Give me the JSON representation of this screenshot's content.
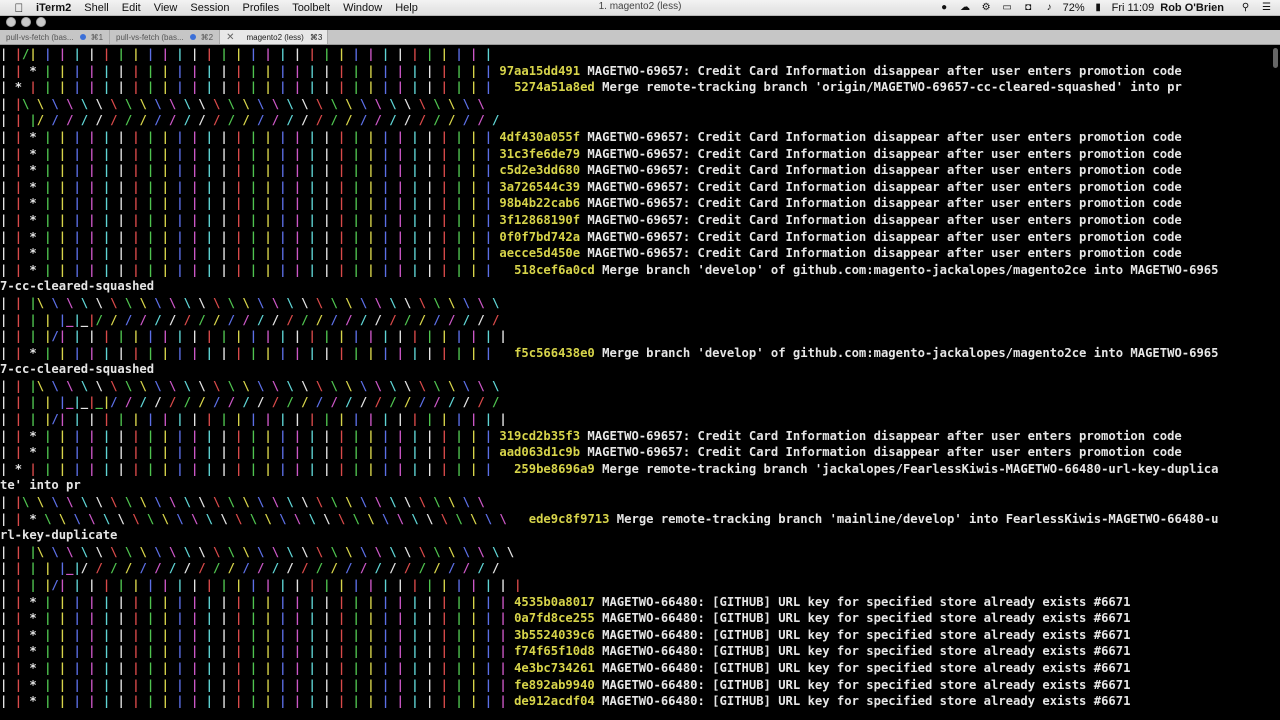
{
  "menubar": {
    "app": "iTerm2",
    "items": [
      "Shell",
      "Edit",
      "View",
      "Session",
      "Profiles",
      "Toolbelt",
      "Window",
      "Help"
    ],
    "window_title": "1. magento2 (less)",
    "status": {
      "battery": "72%",
      "clock": "Fri 11:09",
      "user": "Rob O'Brien"
    }
  },
  "tabs": [
    {
      "title": "pull-vs-fetch (bas...",
      "shortcut": "⌘1"
    },
    {
      "title": "pull-vs-fetch (bas...",
      "shortcut": "⌘2"
    },
    {
      "title": "magento2 (less)",
      "shortcut": "⌘3"
    }
  ],
  "colors": {
    "graph": [
      "#e3e3e3",
      "#d94a4a",
      "#4fc34f",
      "#d7d44a",
      "#5c6fe6",
      "#cb57c6",
      "#5fd5d5"
    ],
    "hash": "#d7d44a",
    "text": "#e6e6e6",
    "background": "#000000"
  },
  "terminal": {
    "lines": [
      {
        "graph": "| |/| | | | | | | | | | | | | | | | | | | | | | | | | | | | | | | |",
        "hash": "",
        "text": ""
      },
      {
        "graph": "| | * | | | | | | | | | | | | | | | | | | | | | | | | | | | | | | | ",
        "hash": "97aa15dd491",
        "text": " MAGETWO-69657: Credit Card Information disappear after user enters promotion code"
      },
      {
        "graph": "| * | | | | | | | | | | | | | | | | | | | | | | | | | | | | | | | |   ",
        "hash": "5274a51a8ed",
        "text": " Merge remote-tracking branch 'origin/MAGETWO-69657-cc-cleared-squashed' into pr"
      },
      {
        "graph": "| |\\ \\ \\ \\ \\ \\ \\ \\ \\ \\ \\ \\ \\ \\ \\ \\ \\ \\ \\ \\ \\ \\ \\ \\ \\ \\ \\ \\ \\ \\ \\ \\",
        "hash": "",
        "text": ""
      },
      {
        "graph": "| | |/ / / / / / / / / / / / / / / / / / / / / / / / / / / / / / / /",
        "hash": "",
        "text": ""
      },
      {
        "graph": "| | * | | | | | | | | | | | | | | | | | | | | | | | | | | | | | | | ",
        "hash": "4df430a055f",
        "text": " MAGETWO-69657: Credit Card Information disappear after user enters promotion code"
      },
      {
        "graph": "| | * | | | | | | | | | | | | | | | | | | | | | | | | | | | | | | | ",
        "hash": "31c3fe6de79",
        "text": " MAGETWO-69657: Credit Card Information disappear after user enters promotion code"
      },
      {
        "graph": "| | * | | | | | | | | | | | | | | | | | | | | | | | | | | | | | | | ",
        "hash": "c5d2e3dd680",
        "text": " MAGETWO-69657: Credit Card Information disappear after user enters promotion code"
      },
      {
        "graph": "| | * | | | | | | | | | | | | | | | | | | | | | | | | | | | | | | | ",
        "hash": "3a726544c39",
        "text": " MAGETWO-69657: Credit Card Information disappear after user enters promotion code"
      },
      {
        "graph": "| | * | | | | | | | | | | | | | | | | | | | | | | | | | | | | | | | ",
        "hash": "98b4b22cab6",
        "text": " MAGETWO-69657: Credit Card Information disappear after user enters promotion code"
      },
      {
        "graph": "| | * | | | | | | | | | | | | | | | | | | | | | | | | | | | | | | | ",
        "hash": "3f12868190f",
        "text": " MAGETWO-69657: Credit Card Information disappear after user enters promotion code"
      },
      {
        "graph": "| | * | | | | | | | | | | | | | | | | | | | | | | | | | | | | | | | ",
        "hash": "0f0f7bd742a",
        "text": " MAGETWO-69657: Credit Card Information disappear after user enters promotion code"
      },
      {
        "graph": "| | * | | | | | | | | | | | | | | | | | | | | | | | | | | | | | | | ",
        "hash": "aecce5d450e",
        "text": " MAGETWO-69657: Credit Card Information disappear after user enters promotion code"
      },
      {
        "graph": "| | * | | | | | | | | | | | | | | | | | | | | | | | | | | | | | | |   ",
        "hash": "518cef6a0cd",
        "text": " Merge branch 'develop' of github.com:magento-jackalopes/magento2ce into MAGETWO-6965"
      },
      {
        "graph": "",
        "hash": "",
        "text": "7-cc-cleared-squashed"
      },
      {
        "graph": "| | |\\ \\ \\ \\ \\ \\ \\ \\ \\ \\ \\ \\ \\ \\ \\ \\ \\ \\ \\ \\ \\ \\ \\ \\ \\ \\ \\ \\ \\ \\ \\ \\",
        "hash": "",
        "text": ""
      },
      {
        "graph": "| | | | |_|_|/ / / / / / / / / / / / / / / / / / / / / / / / / / / /",
        "hash": "",
        "text": ""
      },
      {
        "graph": "| | | |/| | | | | | | | | | | | | | | | | | | | | | | | | | | | | | |",
        "hash": "",
        "text": ""
      },
      {
        "graph": "| | * | | | | | | | | | | | | | | | | | | | | | | | | | | | | | | |   ",
        "hash": "f5c566438e0",
        "text": " Merge branch 'develop' of github.com:magento-jackalopes/magento2ce into MAGETWO-6965"
      },
      {
        "graph": "",
        "hash": "",
        "text": "7-cc-cleared-squashed"
      },
      {
        "graph": "| | |\\ \\ \\ \\ \\ \\ \\ \\ \\ \\ \\ \\ \\ \\ \\ \\ \\ \\ \\ \\ \\ \\ \\ \\ \\ \\ \\ \\ \\ \\ \\ \\",
        "hash": "",
        "text": ""
      },
      {
        "graph": "| | | | |_|_|_|/ / / / / / / / / / / / / / / / / / / / / / / / / / /",
        "hash": "",
        "text": ""
      },
      {
        "graph": "| | | |/| | | | | | | | | | | | | | | | | | | | | | | | | | | | | | |",
        "hash": "",
        "text": ""
      },
      {
        "graph": "| | * | | | | | | | | | | | | | | | | | | | | | | | | | | | | | | | ",
        "hash": "319cd2b35f3",
        "text": " MAGETWO-69657: Credit Card Information disappear after user enters promotion code"
      },
      {
        "graph": "| | * | | | | | | | | | | | | | | | | | | | | | | | | | | | | | | | ",
        "hash": "aad063d1c9b",
        "text": " MAGETWO-69657: Credit Card Information disappear after user enters promotion code"
      },
      {
        "graph": "| * | | | | | | | | | | | | | | | | | | | | | | | | | | | | | | | |   ",
        "hash": "259be8696a9",
        "text": " Merge remote-tracking branch 'jackalopes/FearlessKiwis-MAGETWO-66480-url-key-duplica"
      },
      {
        "graph": "",
        "hash": "",
        "text": "te' into pr"
      },
      {
        "graph": "| |\\ \\ \\ \\ \\ \\ \\ \\ \\ \\ \\ \\ \\ \\ \\ \\ \\ \\ \\ \\ \\ \\ \\ \\ \\ \\ \\ \\ \\ \\ \\ \\",
        "hash": "",
        "text": ""
      },
      {
        "graph": "| | * \\ \\ \\ \\ \\ \\ \\ \\ \\ \\ \\ \\ \\ \\ \\ \\ \\ \\ \\ \\ \\ \\ \\ \\ \\ \\ \\ \\ \\ \\ \\ \\   ",
        "hash": "ede9c8f9713",
        "text": " Merge remote-tracking branch 'mainline/develop' into FearlessKiwis-MAGETWO-66480-u"
      },
      {
        "graph": "",
        "hash": "",
        "text": "rl-key-duplicate"
      },
      {
        "graph": "| | |\\ \\ \\ \\ \\ \\ \\ \\ \\ \\ \\ \\ \\ \\ \\ \\ \\ \\ \\ \\ \\ \\ \\ \\ \\ \\ \\ \\ \\ \\ \\ \\ \\",
        "hash": "",
        "text": ""
      },
      {
        "graph": "| | | | |_|/ / / / / / / / / / / / / / / / / / / / / / / / / / / / /",
        "hash": "",
        "text": ""
      },
      {
        "graph": "| | | |/| | | | | | | | | | | | | | | | | | | | | | | | | | | | | | | |",
        "hash": "",
        "text": ""
      },
      {
        "graph": "| | * | | | | | | | | | | | | | | | | | | | | | | | | | | | | | | | | ",
        "hash": "4535b0a8017",
        "text": " MAGETWO-66480: [GITHUB] URL key for specified store already exists #6671"
      },
      {
        "graph": "| | * | | | | | | | | | | | | | | | | | | | | | | | | | | | | | | | | ",
        "hash": "0a7fd8ce255",
        "text": " MAGETWO-66480: [GITHUB] URL key for specified store already exists #6671"
      },
      {
        "graph": "| | * | | | | | | | | | | | | | | | | | | | | | | | | | | | | | | | | ",
        "hash": "3b5524039c6",
        "text": " MAGETWO-66480: [GITHUB] URL key for specified store already exists #6671"
      },
      {
        "graph": "| | * | | | | | | | | | | | | | | | | | | | | | | | | | | | | | | | | ",
        "hash": "f74f65f10d8",
        "text": " MAGETWO-66480: [GITHUB] URL key for specified store already exists #6671"
      },
      {
        "graph": "| | * | | | | | | | | | | | | | | | | | | | | | | | | | | | | | | | | ",
        "hash": "4e3bc734261",
        "text": " MAGETWO-66480: [GITHUB] URL key for specified store already exists #6671"
      },
      {
        "graph": "| | * | | | | | | | | | | | | | | | | | | | | | | | | | | | | | | | | ",
        "hash": "fe892ab9940",
        "text": " MAGETWO-66480: [GITHUB] URL key for specified store already exists #6671"
      },
      {
        "graph": "| | * | | | | | | | | | | | | | | | | | | | | | | | | | | | | | | | | ",
        "hash": "de912acdf04",
        "text": " MAGETWO-66480: [GITHUB] URL key for specified store already exists #6671"
      }
    ]
  }
}
